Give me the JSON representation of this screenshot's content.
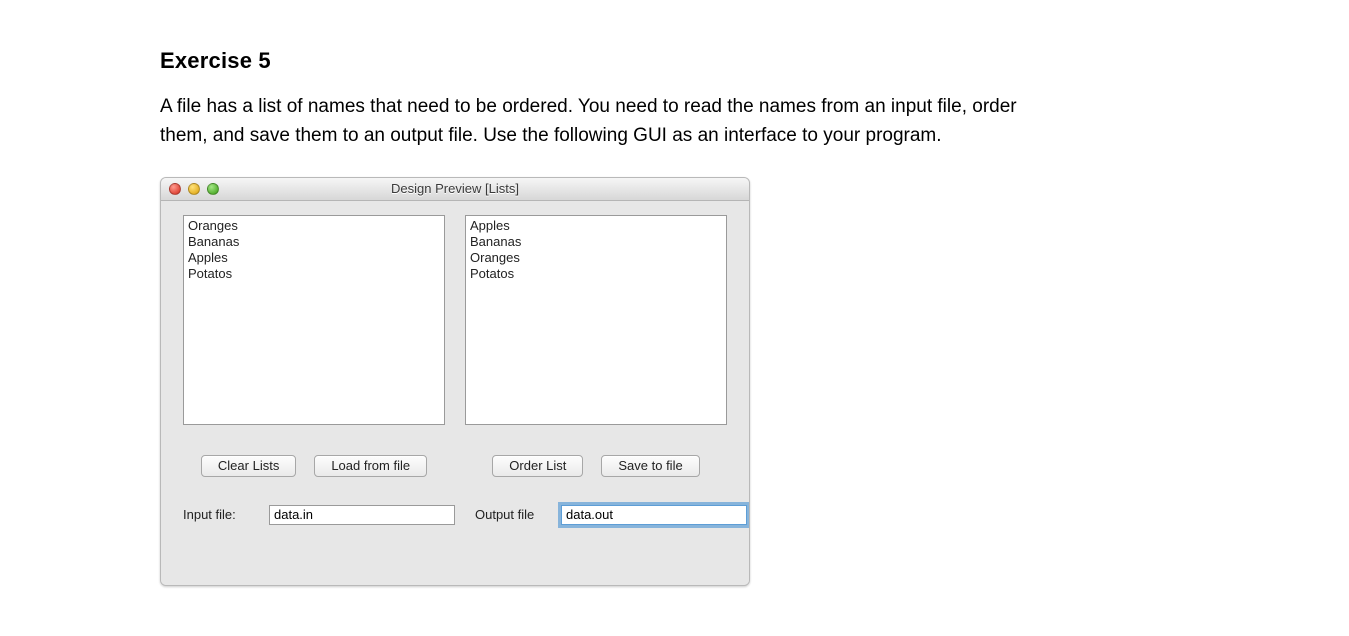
{
  "exercise": {
    "title": "Exercise 5",
    "description": "A file has a list of names that need to be ordered. You need to read the names from an input file, order them, and save them to an output file. Use the following GUI as an interface to your program."
  },
  "window": {
    "title": "Design Preview [Lists]"
  },
  "lists": {
    "input": [
      "Oranges",
      "Bananas",
      "Apples",
      "Potatos"
    ],
    "output": [
      "Apples",
      "Bananas",
      "Oranges",
      "Potatos"
    ]
  },
  "buttons": {
    "clear": "Clear Lists",
    "load": "Load from file",
    "order": "Order List",
    "save": "Save to file"
  },
  "files": {
    "input_label": "Input file:",
    "input_value": "data.in",
    "output_label": "Output file",
    "output_value": "data.out"
  }
}
